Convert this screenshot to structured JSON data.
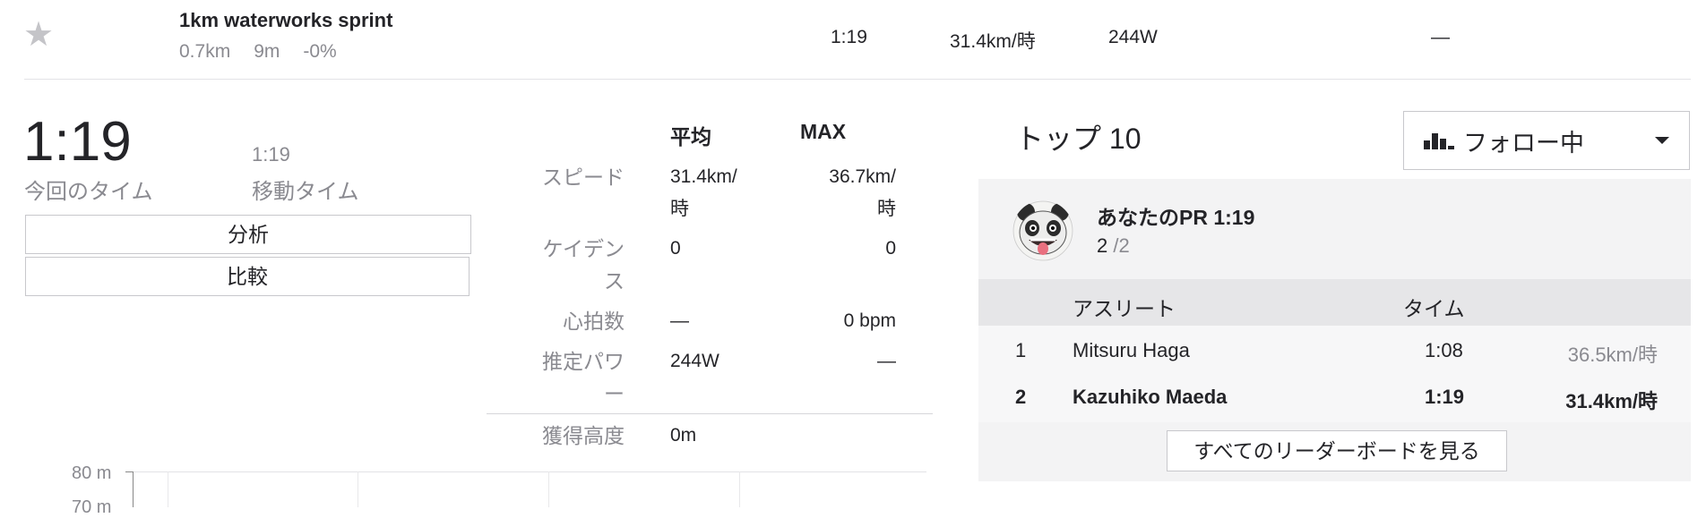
{
  "segment": {
    "name": "1km waterworks sprint",
    "distance": "0.7km",
    "elevation": "9m",
    "grade": "-0%",
    "time": "1:19",
    "speed": "31.4km/時",
    "power": "244W",
    "extra": "—"
  },
  "effort": {
    "elapsed_time": "1:19",
    "elapsed_label": "今回のタイム",
    "moving_time": "1:19",
    "moving_label": "移動タイム",
    "analyze_button": "分析",
    "compare_button": "比較"
  },
  "stats": {
    "header_avg": "平均",
    "header_max": "MAX",
    "rows": [
      {
        "label_1": "スピード",
        "label_2": "",
        "avg_1": "31.4km/",
        "avg_2": "時",
        "max_1": "36.7km/",
        "max_2": "時"
      },
      {
        "label_1": "ケイデン",
        "label_2": "ス",
        "avg_1": "0",
        "avg_2": "",
        "max_1": "0",
        "max_2": ""
      },
      {
        "label_1": "心拍数",
        "label_2": "",
        "avg_1": "—",
        "avg_2": "",
        "max_1": "0 bpm",
        "max_2": ""
      },
      {
        "label_1": "推定パワ",
        "label_2": "ー",
        "avg_1": "244W",
        "avg_2": "",
        "max_1": "—",
        "max_2": ""
      }
    ],
    "elevation_gain_label": "獲得高度",
    "elevation_gain_value": "0m"
  },
  "elevation_chart": {
    "y_tick_top": "80 m",
    "y_tick_next": "70 m"
  },
  "leaderboard": {
    "title": "トップ 10",
    "filter_label": "フォロー中",
    "pr_label": "あなたのPR 1:19",
    "pr_rank": "2",
    "pr_total": "/2",
    "col_athlete": "アスリート",
    "col_time": "タイム",
    "rows": [
      {
        "rank": "1",
        "athlete": "Mitsuru Haga",
        "time": "1:08",
        "speed": "36.5km/時",
        "highlight": false
      },
      {
        "rank": "2",
        "athlete": "Kazuhiko Maeda",
        "time": "1:19",
        "speed": "31.4km/時",
        "highlight": true
      }
    ],
    "view_all_button": "すべてのリーダーボードを見る"
  },
  "icons": {
    "star": "star-icon",
    "chart": "bar-chart-icon",
    "caret": "caret-down-icon",
    "avatar": "panda-avatar"
  },
  "colors": {
    "text": "#242428",
    "muted": "#8a8a90",
    "panel": "#f3f3f4",
    "panel_header": "#e6e6e8"
  }
}
